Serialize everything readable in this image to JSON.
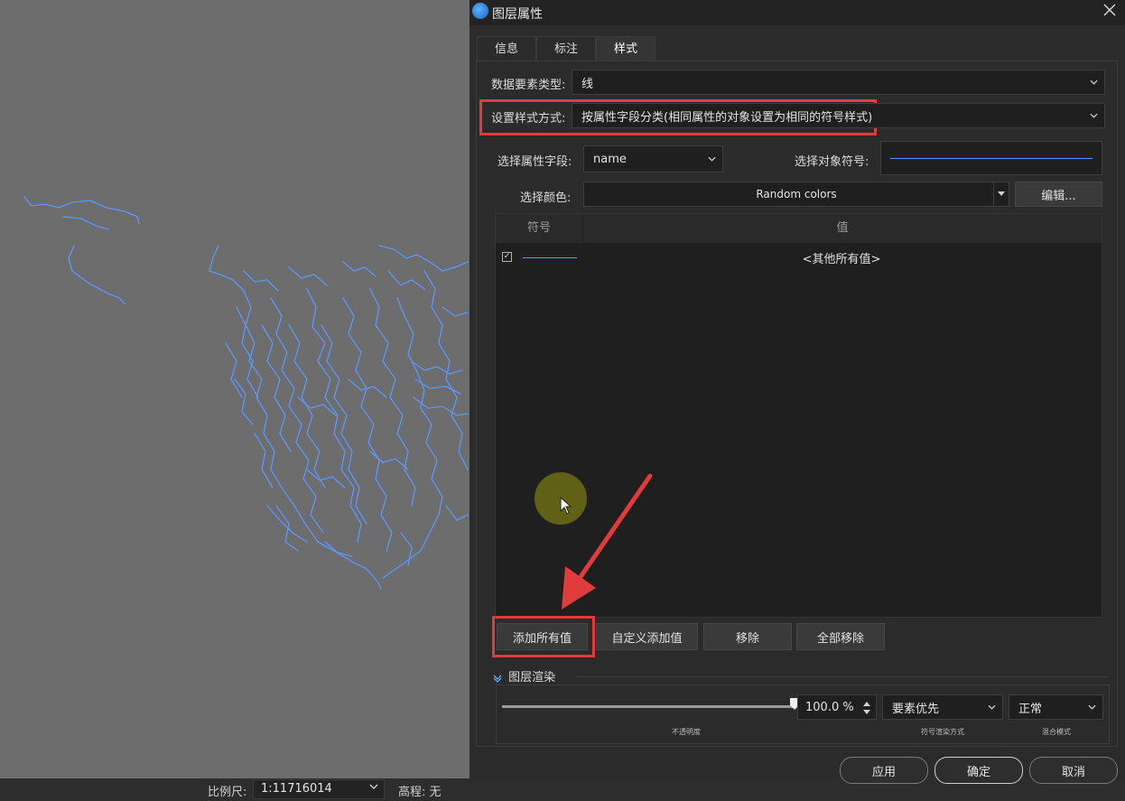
{
  "status": {
    "scale_label": "比例尺:",
    "scale_value": "1:11716014",
    "elevation": "高程: 无"
  },
  "dialog": {
    "title": "图层属性",
    "tabs": [
      {
        "label": "信息"
      },
      {
        "label": "标注"
      },
      {
        "label": "样式"
      }
    ],
    "feature_type_label": "数据要素类型:",
    "feature_type_value": "线",
    "style_method_label": "设置样式方式:",
    "style_method_value": "按属性字段分类(相同属性的对象设置为相同的符号样式)",
    "attr_field_label": "选择属性字段:",
    "attr_field_value": "name",
    "symbol_label": "选择对象符号:",
    "color_label": "选择颜色:",
    "color_value": "Random colors",
    "edit_button": "编辑...",
    "table": {
      "col_symbol": "符号",
      "col_value": "值",
      "rows": [
        {
          "checked": true,
          "value": "<其他所有值>"
        }
      ]
    },
    "buttons": {
      "add_all": "添加所有值",
      "custom_add": "自定义添加值",
      "remove": "移除",
      "remove_all": "全部移除"
    },
    "render": {
      "section_label": "图层渲染",
      "opacity_value": "100.0 %",
      "opacity_level": 1.0,
      "opacity_caption": "不透明度",
      "symbol_order_value": "要素优先",
      "symbol_order_caption": "符号渲染方式",
      "blend_value": "正常",
      "blend_caption": "混合模式"
    },
    "footer": {
      "apply": "应用",
      "ok": "确定",
      "cancel": "取消"
    }
  },
  "colors": {
    "highlight_red": "#e23b3b",
    "river_blue": "#5d97ff"
  }
}
